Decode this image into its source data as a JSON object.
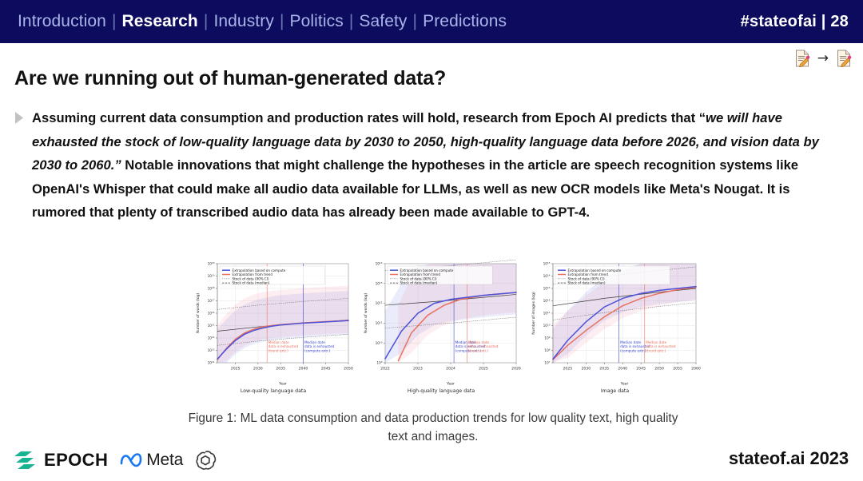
{
  "header": {
    "nav_items": [
      {
        "label": "Introduction",
        "active": false
      },
      {
        "label": "Research",
        "active": true
      },
      {
        "label": "Industry",
        "active": false
      },
      {
        "label": "Politics",
        "active": false
      },
      {
        "label": "Safety",
        "active": false
      },
      {
        "label": "Predictions",
        "active": false
      }
    ],
    "separator": "|",
    "brand_tag": "#stateofai | 28",
    "bg_color": "#0d0b5e",
    "inactive_color": "#a9b4e8",
    "active_color": "#ffffff"
  },
  "nav_icons": {
    "prev_icon": "document-pencil-icon",
    "arrow": "→",
    "next_icon": "document-pencil-icon"
  },
  "title": "Are we running out of human-generated data?",
  "body": {
    "bullet_icon": "triangle-bullet-icon",
    "segments": [
      {
        "text": "Assuming current data consumption and production rates will hold, research from Epoch AI predicts that “",
        "italic": false
      },
      {
        "text": "we will have exhausted the stock of low-quality language data by 2030 to 2050, high-quality language data before 2026, and vision data by 2030 to 2060.”",
        "italic": true
      },
      {
        "text": " Notable innovations that might challenge the hypotheses in the article are speech recognition systems like OpenAI's Whisper that could make all audio data available for LLMs, as well as new OCR models like Meta's Nougat. It is rumored that plenty of transcribed audio data has already been made available to GPT-4.",
        "italic": false
      }
    ]
  },
  "figure": {
    "caption": "Figure 1: ML data consumption and data production trends for low quality text, high quality text and images."
  },
  "chart_data": [
    {
      "type": "line",
      "title": "",
      "subtitle": "Low-quality language data",
      "xlabel": "Year",
      "ylabel": "Number of words (log)",
      "xlim": [
        2021,
        2050
      ],
      "xticks": [
        "2025",
        "2030",
        "2035",
        "2040",
        "2045",
        "2050"
      ],
      "ylim_exp": [
        12,
        20
      ],
      "yticks": [
        "10¹²",
        "10¹³",
        "10¹⁴",
        "10¹⁵",
        "10¹⁶",
        "10¹⁷",
        "10¹⁸",
        "10¹⁹",
        "10²⁰"
      ],
      "grid": true,
      "legend_position": "upper-left",
      "legend": [
        {
          "label": "Extrapolation based on compute",
          "color": "#4d52d8",
          "style": "solid"
        },
        {
          "label": "Extrapolation from trend",
          "color": "#e8715f",
          "style": "solid"
        },
        {
          "label": "Stock of data (90% CI)",
          "color": "#555555",
          "style": "dotted"
        },
        {
          "label": "Stock of data (median)",
          "color": "#333333",
          "style": "dashed"
        }
      ],
      "annotations": [
        {
          "text": "Median date\ndata is exhausted\n(trend extr.)",
          "color": "#e8715f",
          "x_year": 2032
        },
        {
          "text": "Median date\ndata is exhausted\n(compute extr.)",
          "color": "#3b46d0",
          "x_year": 2040
        }
      ],
      "vlines": [
        {
          "x_year": 2032,
          "color": "#e8715f"
        },
        {
          "x_year": 2040,
          "color": "#3b46d0"
        }
      ],
      "series": [
        {
          "name": "Extrapolation based on compute",
          "color": "#4d52d8",
          "x": [
            2021,
            2023,
            2025,
            2027,
            2029,
            2031,
            2033,
            2035,
            2040,
            2045,
            2050
          ],
          "y_exp": [
            12.3,
            13.1,
            13.8,
            14.3,
            14.6,
            14.8,
            14.95,
            15.05,
            15.2,
            15.3,
            15.4
          ]
        },
        {
          "name": "Extrapolation from trend",
          "color": "#e8715f",
          "x": [
            2021,
            2023,
            2025,
            2027,
            2029,
            2031,
            2033,
            2035,
            2040,
            2045,
            2050
          ],
          "y_exp": [
            12.25,
            13.15,
            13.9,
            14.4,
            14.7,
            14.9,
            15.0,
            15.08,
            15.22,
            15.32,
            15.42
          ]
        },
        {
          "name": "Stock of data (median)",
          "color": "#333333",
          "x": [
            2021,
            2030,
            2040,
            2050
          ],
          "y_exp": [
            14.55,
            14.9,
            15.2,
            15.45
          ]
        }
      ]
    },
    {
      "type": "line",
      "title": "",
      "subtitle": "High-quality language data",
      "xlabel": "Year",
      "ylabel": "Number of words (log)",
      "xlim": [
        2022,
        2026
      ],
      "xticks": [
        "2022",
        "2023",
        "2024",
        "2025",
        "2026"
      ],
      "ylim_exp": [
        9,
        14
      ],
      "yticks": [
        "10¹¹",
        "10¹²",
        "10¹³"
      ],
      "grid": true,
      "legend_position": "upper-left",
      "legend": [
        {
          "label": "Extrapolation based on compute",
          "color": "#4d52d8",
          "style": "solid"
        },
        {
          "label": "Extrapolation from trend",
          "color": "#e8715f",
          "style": "solid"
        },
        {
          "label": "Stock of data (90% CI)",
          "color": "#555555",
          "style": "dotted"
        },
        {
          "label": "Stock of data (median)",
          "color": "#333333",
          "style": "dashed"
        }
      ],
      "annotations": [
        {
          "text": "Median date\ndata is exhausted\n(compute extr.)",
          "color": "#3b46d0",
          "x_year": 2024.1
        },
        {
          "text": "Median date\ndata is exhausted\n(trend extr.)",
          "color": "#e8715f",
          "x_year": 2024.5
        }
      ],
      "vlines": [
        {
          "x_year": 2024.1,
          "color": "#3b46d0"
        },
        {
          "x_year": 2024.5,
          "color": "#e8715f"
        }
      ],
      "series": [
        {
          "name": "Extrapolation based on compute",
          "color": "#4d52d8",
          "x": [
            2022,
            2022.5,
            2023,
            2023.5,
            2024,
            2025,
            2026
          ],
          "y_exp": [
            9.2,
            10.6,
            11.5,
            12.0,
            12.2,
            12.4,
            12.55
          ]
        },
        {
          "name": "Extrapolation from trend",
          "color": "#e8715f",
          "x": [
            2022.4,
            2022.8,
            2023.3,
            2023.8,
            2024.3,
            2025,
            2026
          ],
          "y_exp": [
            9.1,
            10.5,
            11.4,
            11.9,
            12.2,
            12.4,
            12.55
          ]
        },
        {
          "name": "Stock of data (median)",
          "color": "#333333",
          "x": [
            2022,
            2024,
            2026
          ],
          "y_exp": [
            11.9,
            12.15,
            12.45
          ]
        }
      ]
    },
    {
      "type": "line",
      "title": "",
      "subtitle": "Image data",
      "xlabel": "Year",
      "ylabel": "Number of images (log)",
      "xlim": [
        2021,
        2060
      ],
      "xticks": [
        "2025",
        "2030",
        "2035",
        "2040",
        "2045",
        "2050",
        "2055",
        "2060"
      ],
      "ylim_exp": [
        7,
        15
      ],
      "yticks": [
        "10⁷",
        "10⁸",
        "10⁹",
        "10¹⁰",
        "10¹¹",
        "10¹²",
        "10¹³",
        "10¹⁴",
        "10¹⁵"
      ],
      "grid": true,
      "legend_position": "upper-left",
      "legend": [
        {
          "label": "Extrapolation based on compute",
          "color": "#4d52d8",
          "style": "solid"
        },
        {
          "label": "Extrapolation from trend",
          "color": "#e8715f",
          "style": "solid"
        },
        {
          "label": "Stock of data (90% CI)",
          "color": "#555555",
          "style": "dotted"
        },
        {
          "label": "Stock of data (median)",
          "color": "#333333",
          "style": "dashed"
        }
      ],
      "annotations": [
        {
          "text": "Median date\ndata is exhausted\n(compute extr.)",
          "color": "#3b46d0",
          "x_year": 2039
        },
        {
          "text": "Median date\ndata is exhausted\n(trend extr.)",
          "color": "#e8715f",
          "x_year": 2046
        }
      ],
      "vlines": [
        {
          "x_year": 2039,
          "color": "#3b46d0"
        },
        {
          "x_year": 2046,
          "color": "#e8715f"
        }
      ],
      "series": [
        {
          "name": "Extrapolation based on compute",
          "color": "#4d52d8",
          "x": [
            2021,
            2025,
            2030,
            2035,
            2040,
            2045,
            2050,
            2055,
            2060
          ],
          "y_exp": [
            7.3,
            8.8,
            10.3,
            11.5,
            12.2,
            12.6,
            12.85,
            13.0,
            13.15
          ]
        },
        {
          "name": "Extrapolation from trend",
          "color": "#e8715f",
          "x": [
            2021,
            2025,
            2030,
            2035,
            2040,
            2045,
            2050,
            2055,
            2060
          ],
          "y_exp": [
            7.25,
            8.4,
            9.6,
            10.7,
            11.6,
            12.2,
            12.6,
            12.9,
            13.1
          ]
        },
        {
          "name": "Stock of data (median)",
          "color": "#333333",
          "x": [
            2021,
            2035,
            2050,
            2060
          ],
          "y_exp": [
            11.6,
            12.2,
            12.7,
            13.0
          ]
        }
      ]
    }
  ],
  "footer": {
    "logos": [
      {
        "name": "epoch-logo",
        "text": "EPOCH",
        "color": "#1fb79a"
      },
      {
        "name": "meta-logo",
        "text": "Meta",
        "color": "#1877f2"
      },
      {
        "name": "openai-logo",
        "text": "",
        "color": "#333333"
      }
    ],
    "right_text": "stateof.ai 2023"
  }
}
